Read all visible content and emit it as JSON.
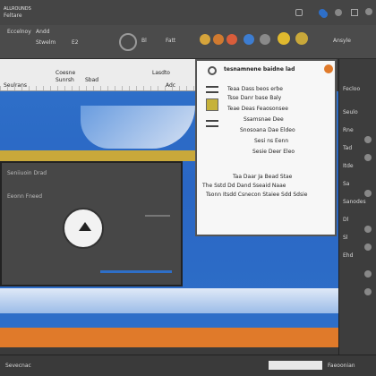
{
  "window": {
    "title": "ALLROUNDS",
    "menu": [
      "Feltare",
      "Adam"
    ]
  },
  "toolbar": {
    "labels": [
      "Eccelnoy",
      "Andd",
      "Stwelm",
      "E2",
      "Bl",
      "Fatt",
      "Ansyle"
    ],
    "icons": [
      "picture-icon",
      "text-icon",
      "fill-icon",
      "shape-icon",
      "brush-icon",
      "gear-icon",
      "star-icon"
    ]
  },
  "ribbon": {
    "row1": [
      "Coesne",
      "Sunrsh",
      "Sbad",
      "Lasdto"
    ],
    "row2": [
      "Seulrans",
      "Adc"
    ]
  },
  "popup": {
    "title": "tesnamnene baidne lad",
    "lines": [
      "Teaa Dass beos erbe",
      "Tsse Danr base Baly",
      "Teae Deas Feaosonsee",
      "Ssamsnae Dee",
      "Snosoana Dae Eldeo",
      "Sesi ns Eenn",
      "Sesie Deer Eleo"
    ],
    "bottom_lines": [
      "Taa Daar Ja Bead Stae",
      "The Sstd Dd Dand Sseaid Naae",
      "Tsonn Itsdd Csnecon Staiee Sdd Sdsie"
    ]
  },
  "player": {
    "title": "Seniiuoin Drad",
    "sub": "Eeonn Fneed"
  },
  "right_panel": {
    "header": "Fecloo",
    "items": [
      "Seulo",
      "Rne",
      "Tad",
      "Itde",
      "Sa",
      "Sanodes",
      "Dl",
      "Sl",
      "Ehd"
    ]
  },
  "status": {
    "left": "Sevecnac",
    "right": "Faeoonian"
  },
  "colors": {
    "accent": "#2e6fc8",
    "orange": "#e07a2a",
    "yellow": "#d9b62b",
    "panel": "#4a4a4a"
  }
}
